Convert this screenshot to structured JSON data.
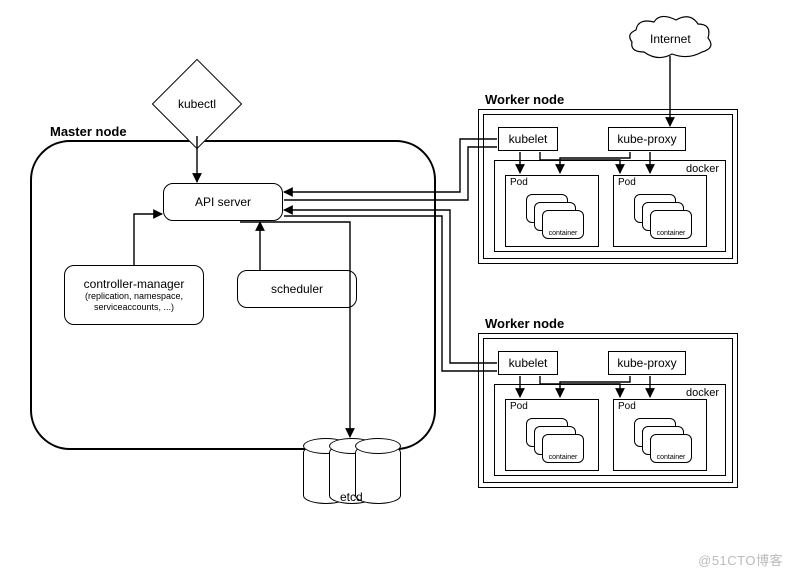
{
  "kubectl": {
    "label": "kubectl"
  },
  "master": {
    "title": "Master node",
    "api_server": "API server",
    "controller_manager": {
      "title": "controller-manager",
      "sub": "(replication, namespace, serviceaccounts, ...)"
    },
    "scheduler": "scheduler"
  },
  "etcd": {
    "label": "etcd"
  },
  "internet": {
    "label": "Internet"
  },
  "worker1": {
    "title": "Worker node",
    "kubelet": "kubelet",
    "kube_proxy": "kube-proxy",
    "docker": "docker",
    "pod_label": "Pod",
    "container_label": "container"
  },
  "worker2": {
    "title": "Worker node",
    "kubelet": "kubelet",
    "kube_proxy": "kube-proxy",
    "docker": "docker",
    "pod_label": "Pod",
    "container_label": "container"
  },
  "watermark": "@51CTO博客"
}
